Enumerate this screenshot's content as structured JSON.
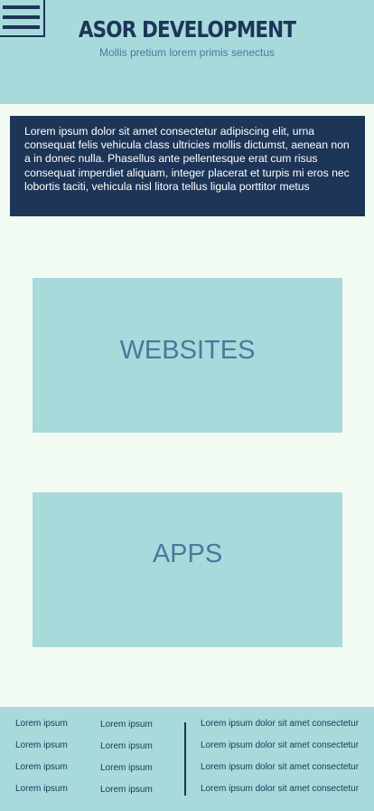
{
  "header": {
    "title": "ASOR DEVELOPMENT",
    "subtitle": "Mollis pretium lorem primis senectus",
    "menu_icon": "hamburger-menu-icon"
  },
  "intro": {
    "text": "Lorem ipsum dolor sit amet consectetur adipiscing elit, urna consequat felis vehicula class ultricies mollis dictumst, aenean non a in donec nulla. Phasellus ante pellentesque erat cum risus consequat imperdiet aliquam, integer placerat et turpis mi eros nec lobortis taciti, vehicula nisl litora tellus ligula porttitor metus"
  },
  "tiles": [
    {
      "label": "WEBSITES"
    },
    {
      "label": "APPS"
    }
  ],
  "footer": {
    "col1": [
      "Lorem ipsum",
      "Lorem ipsum",
      "Lorem ipsum",
      "Lorem ipsum"
    ],
    "col2": [
      "Lorem ipsum",
      "Lorem ipsum",
      "Lorem ipsum",
      "Lorem ipsum"
    ],
    "col3": [
      "Lorem ipsum dolor sit amet consectetur",
      "Lorem ipsum dolor sit amet consectetur",
      "Lorem ipsum dolor sit amet consectetur",
      "Lorem ipsum dolor sit amet consectetur"
    ]
  },
  "colors": {
    "background": "#f1fbf2",
    "light_teal": "#a8dadc",
    "navy": "#1d3557",
    "steel_blue": "#457b9d"
  }
}
